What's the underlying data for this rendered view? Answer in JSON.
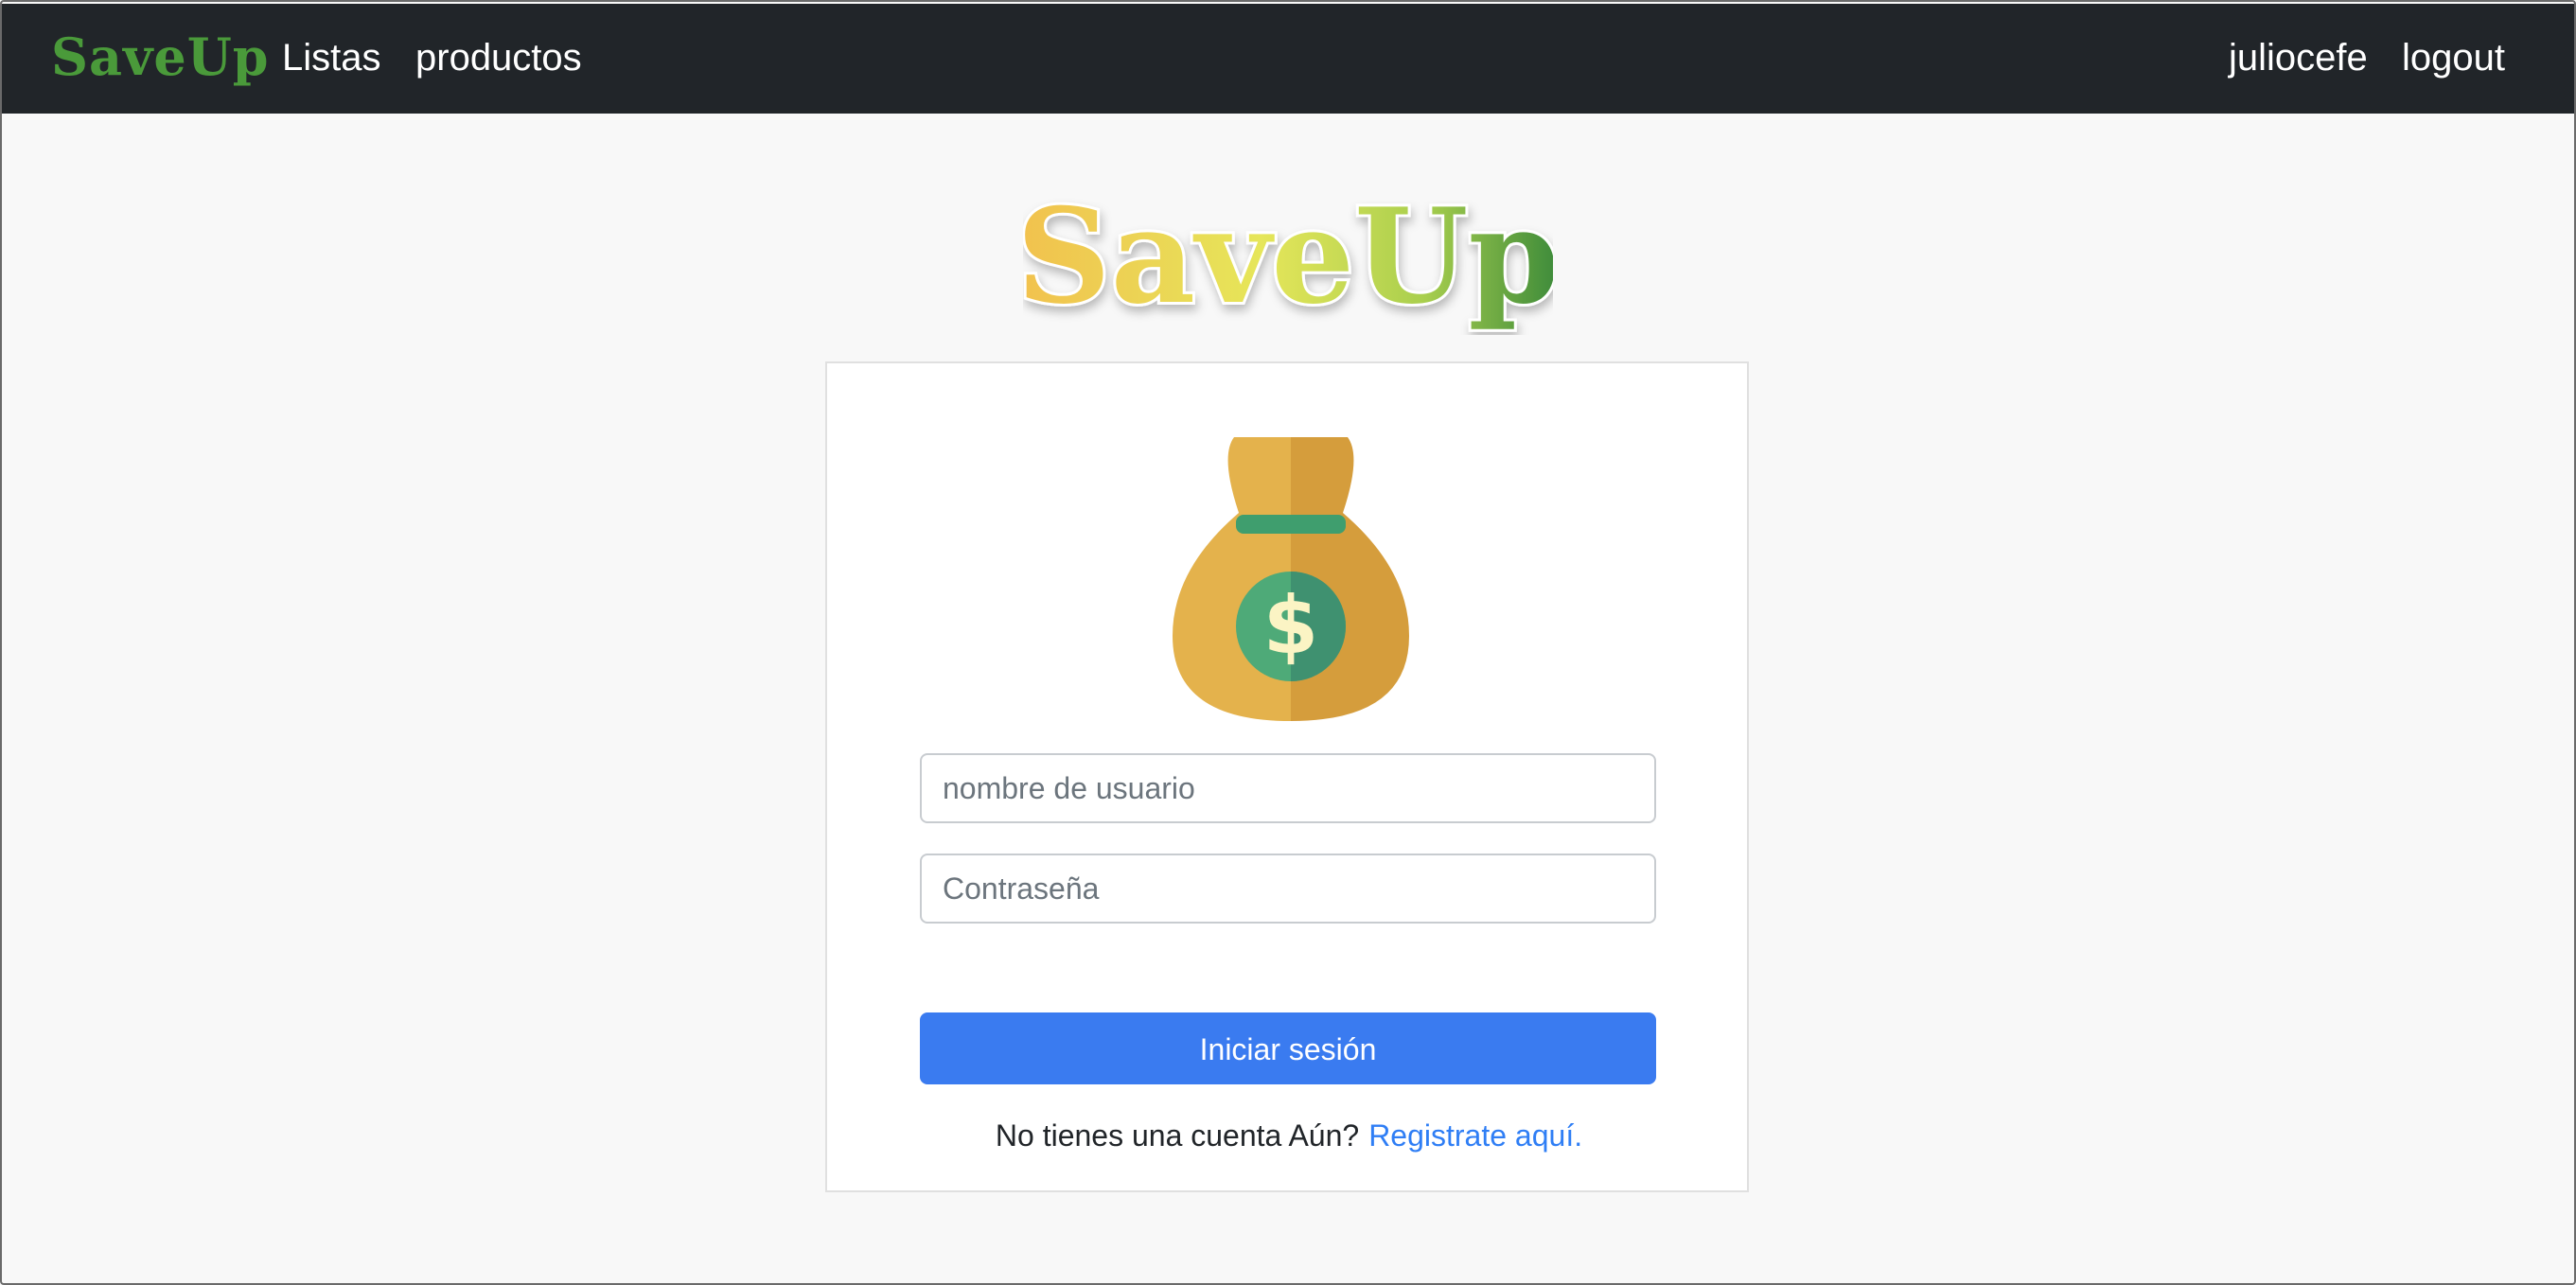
{
  "navbar": {
    "brand": "SaveUp",
    "links": [
      "Listas",
      "productos"
    ],
    "user": "juliocefe",
    "logout": "logout"
  },
  "logo": {
    "text": "SaveUp"
  },
  "login": {
    "username_placeholder": "nombre de usuario",
    "password_placeholder": "Contraseña",
    "submit_label": "Iniciar sesión",
    "signup_prompt": "No tienes una cuenta Aún?",
    "signup_link": "Registrate aquí."
  },
  "colors": {
    "navbar_bg": "#212529",
    "brand": "#4a9a3a",
    "primary_button": "#3a7bf0",
    "link": "#2f7ef5",
    "bag_gold": "#e3b04b",
    "coin_green": "#3f9e6e"
  },
  "icons": {
    "card_image": "money-bag-icon"
  }
}
